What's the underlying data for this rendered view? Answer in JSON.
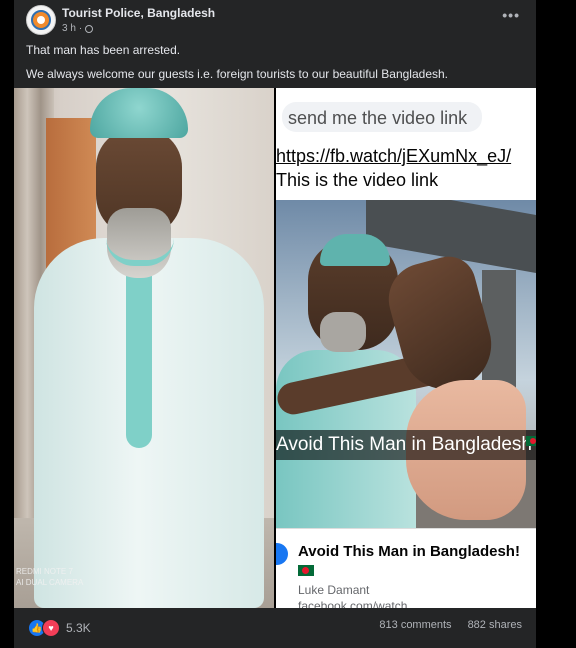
{
  "post": {
    "page_name": "Tourist Police, Bangladesh",
    "time": "3 h",
    "more": "•••",
    "line1": "That man has been arrested.",
    "line2": "We always welcome our guests i.e. foreign tourists to our beautiful Bangladesh."
  },
  "photo_left": {
    "watermark_line1": "REDMI NOTE 7",
    "watermark_line2": "AI DUAL CAMERA"
  },
  "photo_right": {
    "chat_message": "send me the video link",
    "link_text": "https://fb.watch/jEXumNx_eJ/",
    "caption": "This is the video link",
    "video_banner": "Avoid This Man in Bangladesh",
    "card_title": "Avoid This Man in Bangladesh!",
    "card_author": "Luke Damant",
    "card_url": "facebook.com/watch"
  },
  "footer": {
    "reactions": "5.3K",
    "comments": "813 comments",
    "shares": "882 shares"
  },
  "colors": {
    "background": "#000000",
    "card": "#242526",
    "text": "#e4e6eb",
    "muted": "#b0b3b8",
    "like": "#1877f2",
    "love": "#f33e58"
  }
}
